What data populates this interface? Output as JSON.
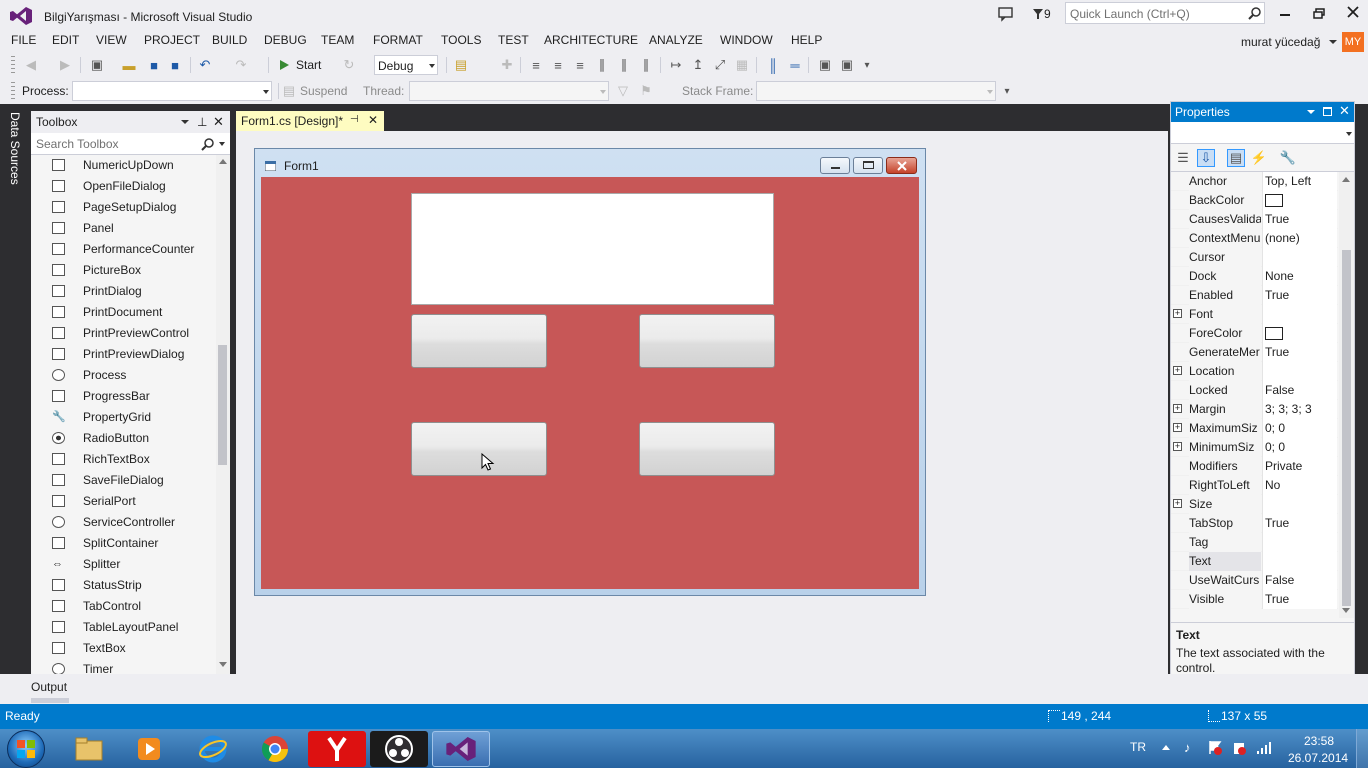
{
  "window": {
    "title": "BilgiYarışması - Microsoft Visual Studio",
    "notification_count": "9",
    "quick_launch_placeholder": "Quick Launch (Ctrl+Q)",
    "user_name": "murat yücedağ",
    "user_initials": "MY",
    "accent_color": "#007acc",
    "vs_purple": "#68217a"
  },
  "menu": [
    "FILE",
    "EDIT",
    "VIEW",
    "PROJECT",
    "BUILD",
    "DEBUG",
    "TEAM",
    "FORMAT",
    "TOOLS",
    "TEST",
    "ARCHITECTURE",
    "ANALYZE",
    "WINDOW",
    "HELP"
  ],
  "toolbar": {
    "start_label": "Start",
    "config_value": "Debug"
  },
  "debug_location": {
    "process_label": "Process:",
    "suspend_label": "Suspend",
    "thread_label": "Thread:",
    "stack_frame_label": "Stack Frame:"
  },
  "left_strip": {
    "data_sources_label": "Data Sources"
  },
  "toolbox": {
    "title": "Toolbox",
    "search_placeholder": "Search Toolbox",
    "items": [
      "NumericUpDown",
      "OpenFileDialog",
      "PageSetupDialog",
      "Panel",
      "PerformanceCounter",
      "PictureBox",
      "PrintDialog",
      "PrintDocument",
      "PrintPreviewControl",
      "PrintPreviewDialog",
      "Process",
      "ProgressBar",
      "PropertyGrid",
      "RadioButton",
      "RichTextBox",
      "SaveFileDialog",
      "SerialPort",
      "ServiceController",
      "SplitContainer",
      "Splitter",
      "StatusStrip",
      "TabControl",
      "TableLayoutPanel",
      "TextBox",
      "Timer"
    ]
  },
  "document_tab": {
    "label": "Form1.cs [Design]*"
  },
  "form": {
    "title": "Form1",
    "back_color": "#c75757"
  },
  "properties": {
    "title": "Properties",
    "rows": [
      {
        "name": "Anchor",
        "value": "Top, Left",
        "expandable": false,
        "color": ""
      },
      {
        "name": "BackColor",
        "value": "",
        "expandable": false,
        "color": "#ffffff"
      },
      {
        "name": "CausesValida",
        "value": "True",
        "expandable": false,
        "color": ""
      },
      {
        "name": "ContextMenu",
        "value": "(none)",
        "expandable": false,
        "color": ""
      },
      {
        "name": "Cursor",
        "value": "",
        "expandable": false,
        "color": ""
      },
      {
        "name": "Dock",
        "value": "None",
        "expandable": false,
        "color": ""
      },
      {
        "name": "Enabled",
        "value": "True",
        "expandable": false,
        "color": ""
      },
      {
        "name": "Font",
        "value": "",
        "expandable": true,
        "color": ""
      },
      {
        "name": "ForeColor",
        "value": "",
        "expandable": false,
        "color": "#ffffff"
      },
      {
        "name": "GenerateMer",
        "value": "True",
        "expandable": false,
        "color": ""
      },
      {
        "name": "Location",
        "value": "",
        "expandable": true,
        "color": ""
      },
      {
        "name": "Locked",
        "value": "False",
        "expandable": false,
        "color": ""
      },
      {
        "name": "Margin",
        "value": "3; 3; 3; 3",
        "expandable": true,
        "color": ""
      },
      {
        "name": "MaximumSiz",
        "value": "0; 0",
        "expandable": true,
        "color": ""
      },
      {
        "name": "MinimumSiz",
        "value": "0; 0",
        "expandable": true,
        "color": ""
      },
      {
        "name": "Modifiers",
        "value": "Private",
        "expandable": false,
        "color": ""
      },
      {
        "name": "RightToLeft",
        "value": "No",
        "expandable": false,
        "color": ""
      },
      {
        "name": "Size",
        "value": "",
        "expandable": true,
        "color": ""
      },
      {
        "name": "TabStop",
        "value": "True",
        "expandable": false,
        "color": ""
      },
      {
        "name": "Tag",
        "value": "",
        "expandable": false,
        "color": ""
      },
      {
        "name": "Text",
        "value": "",
        "expandable": false,
        "color": ""
      },
      {
        "name": "UseWaitCurs",
        "value": "False",
        "expandable": false,
        "color": ""
      },
      {
        "name": "Visible",
        "value": "True",
        "expandable": false,
        "color": ""
      }
    ],
    "description_title": "Text",
    "description_text": "The text associated with the control."
  },
  "output": {
    "label": "Output"
  },
  "status": {
    "ready": "Ready",
    "position": "149 , 244",
    "size": "137 x 55"
  },
  "taskbar": {
    "language": "TR",
    "time": "23:58",
    "date": "26.07.2014"
  }
}
